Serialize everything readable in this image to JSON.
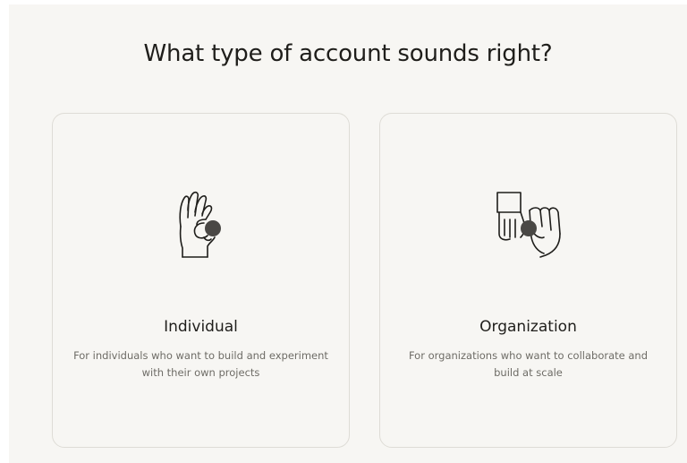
{
  "heading": "What type of account sounds right?",
  "cards": [
    {
      "title": "Individual",
      "description": "For individuals who want to build and experiment with their own projects",
      "icon": "hand-holding-dot-icon"
    },
    {
      "title": "Organization",
      "description": "For organizations who want to collaborate and build at scale",
      "icon": "two-hands-sharing-dot-icon"
    }
  ],
  "colors": {
    "background": "#f7f6f3",
    "card_border": "#dedcd6",
    "text": "#1f1e1b",
    "muted_text": "#6e6c66",
    "dot": "#4a4845"
  }
}
